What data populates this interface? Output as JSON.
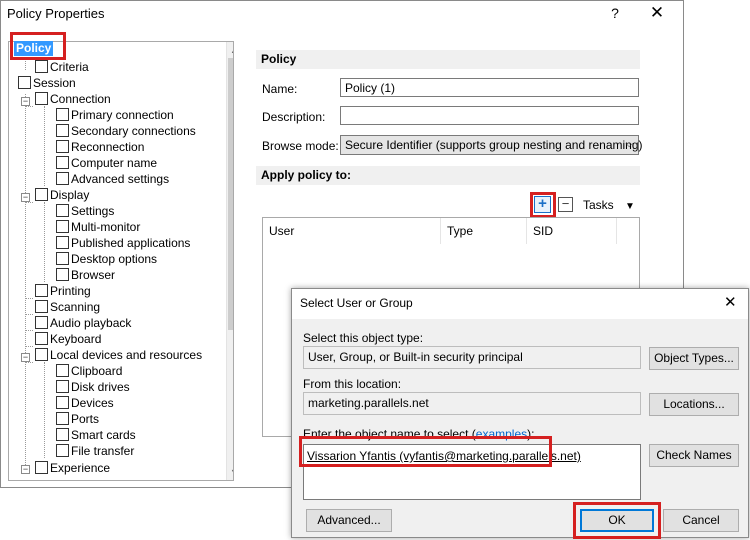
{
  "window": {
    "title": "Policy Properties",
    "help": "?",
    "close": "✕"
  },
  "tree": {
    "items": [
      {
        "label": "Policy"
      },
      {
        "label": "Criteria"
      },
      {
        "label": "Session"
      },
      {
        "label": "Connection"
      },
      {
        "label": "Primary connection"
      },
      {
        "label": "Secondary connections"
      },
      {
        "label": "Reconnection"
      },
      {
        "label": "Computer name"
      },
      {
        "label": "Advanced settings"
      },
      {
        "label": "Display"
      },
      {
        "label": "Settings"
      },
      {
        "label": "Multi-monitor"
      },
      {
        "label": "Published applications"
      },
      {
        "label": "Desktop options"
      },
      {
        "label": "Browser"
      },
      {
        "label": "Printing"
      },
      {
        "label": "Scanning"
      },
      {
        "label": "Audio playback"
      },
      {
        "label": "Keyboard"
      },
      {
        "label": "Local devices and resources"
      },
      {
        "label": "Clipboard"
      },
      {
        "label": "Disk drives"
      },
      {
        "label": "Devices"
      },
      {
        "label": "Ports"
      },
      {
        "label": "Smart cards"
      },
      {
        "label": "File transfer"
      },
      {
        "label": "Experience"
      }
    ],
    "scroll_up": "▲",
    "scroll_down": "▼"
  },
  "policy": {
    "section_title": "Policy",
    "name_label": "Name:",
    "name_value": "Policy (1)",
    "description_label": "Description:",
    "description_value": "",
    "browse_mode_label": "Browse mode:",
    "browse_mode_value": "Secure Identifier (supports group nesting and renaming)",
    "apply_title": "Apply policy to:",
    "add_symbol": "+",
    "remove_symbol": "−",
    "tasks_label": "Tasks",
    "columns": [
      "User",
      "Type",
      "SID"
    ]
  },
  "dialog": {
    "title": "Select User or Group",
    "close": "✕",
    "object_type_label": "Select this object type:",
    "object_type_value": "User, Group, or Built-in security principal",
    "object_types_button": "Object Types...",
    "location_label": "From this location:",
    "location_value": "marketing.parallels.net",
    "locations_button": "Locations...",
    "enter_label_prefix": "Enter the object name to select (",
    "enter_label_link": "examples",
    "enter_label_suffix": "):",
    "object_name_value": "Vissarion Yfantis (vyfantis@marketing.parallels.net)",
    "check_names_button": "Check Names",
    "advanced_button": "Advanced...",
    "ok_button": "OK",
    "cancel_button": "Cancel"
  },
  "colors": {
    "highlight": "#d52020",
    "selection": "#3399ff",
    "link": "#0066cc",
    "add_icon": "#1a6fc7"
  }
}
